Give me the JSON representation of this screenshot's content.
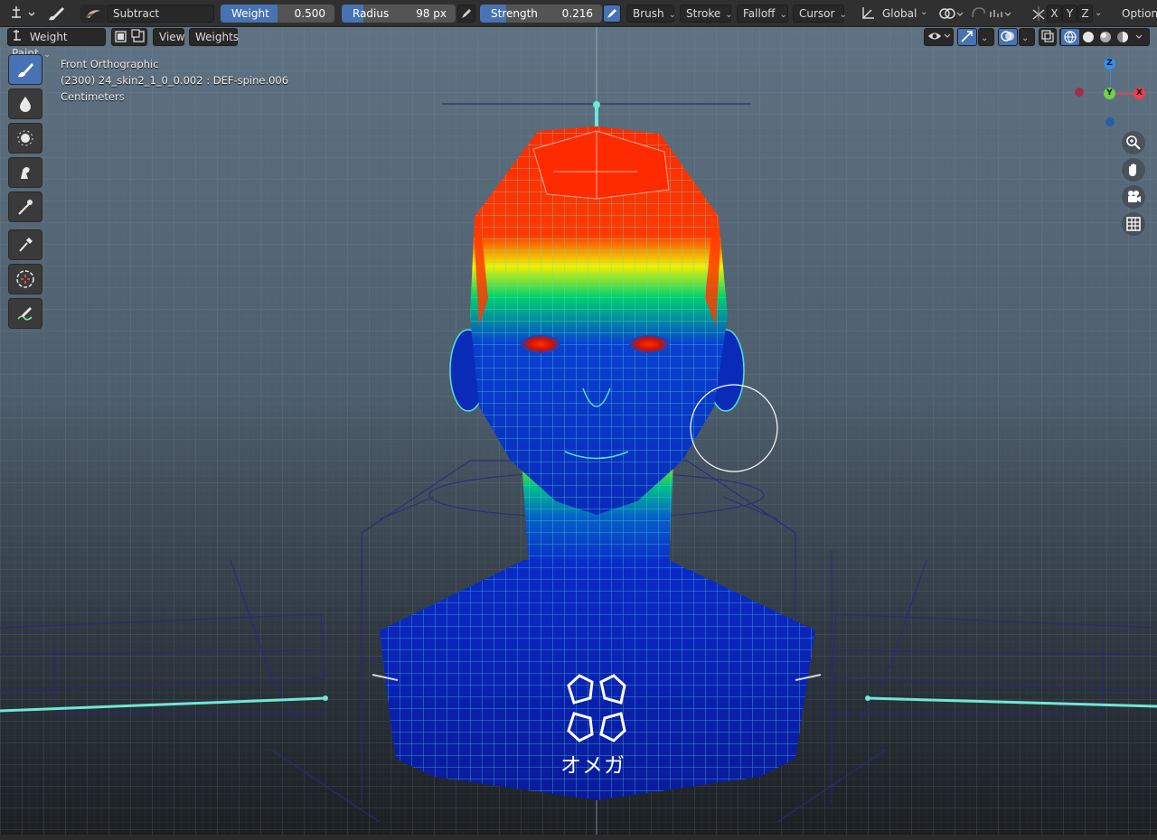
{
  "header": {
    "blend_mode": "Subtract",
    "weight": {
      "label": "Weight",
      "value": "0.500",
      "fraction": 0.5
    },
    "radius": {
      "label": "Radius",
      "value": "98 px"
    },
    "strength": {
      "label": "Strength",
      "value": "0.216",
      "fraction": 0.216
    },
    "menus": [
      "Brush",
      "Stroke",
      "Falloff",
      "Cursor"
    ],
    "orientation": "Global",
    "mirror_axes": [
      "X",
      "Y",
      "Z"
    ],
    "options_label": "Options"
  },
  "mode_row": {
    "mode": "Weight Paint",
    "menus": [
      "View",
      "Weights"
    ]
  },
  "viewport": {
    "view_name": "Front Orthographic",
    "object_info": "(2300) 24_skin2_1_0_0.002 : DEF-spine.006",
    "units": "Centimeters"
  },
  "gizmo": {
    "z": "Z",
    "y": "Y",
    "x": "X"
  },
  "toolbar": {
    "tools": [
      "draw-brush-icon",
      "blur-brush-icon",
      "average-brush-icon",
      "smear-brush-icon",
      "gradient-icon",
      "sample-weight-icon",
      "select-circle-icon",
      "annotate-icon"
    ]
  },
  "watermark": {
    "text": "オメガ"
  },
  "colors": {
    "accent": "#4772b3",
    "weight_high": "#ff2a00",
    "weight_low": "#0a1a9a",
    "wire": "#48e6d8"
  }
}
